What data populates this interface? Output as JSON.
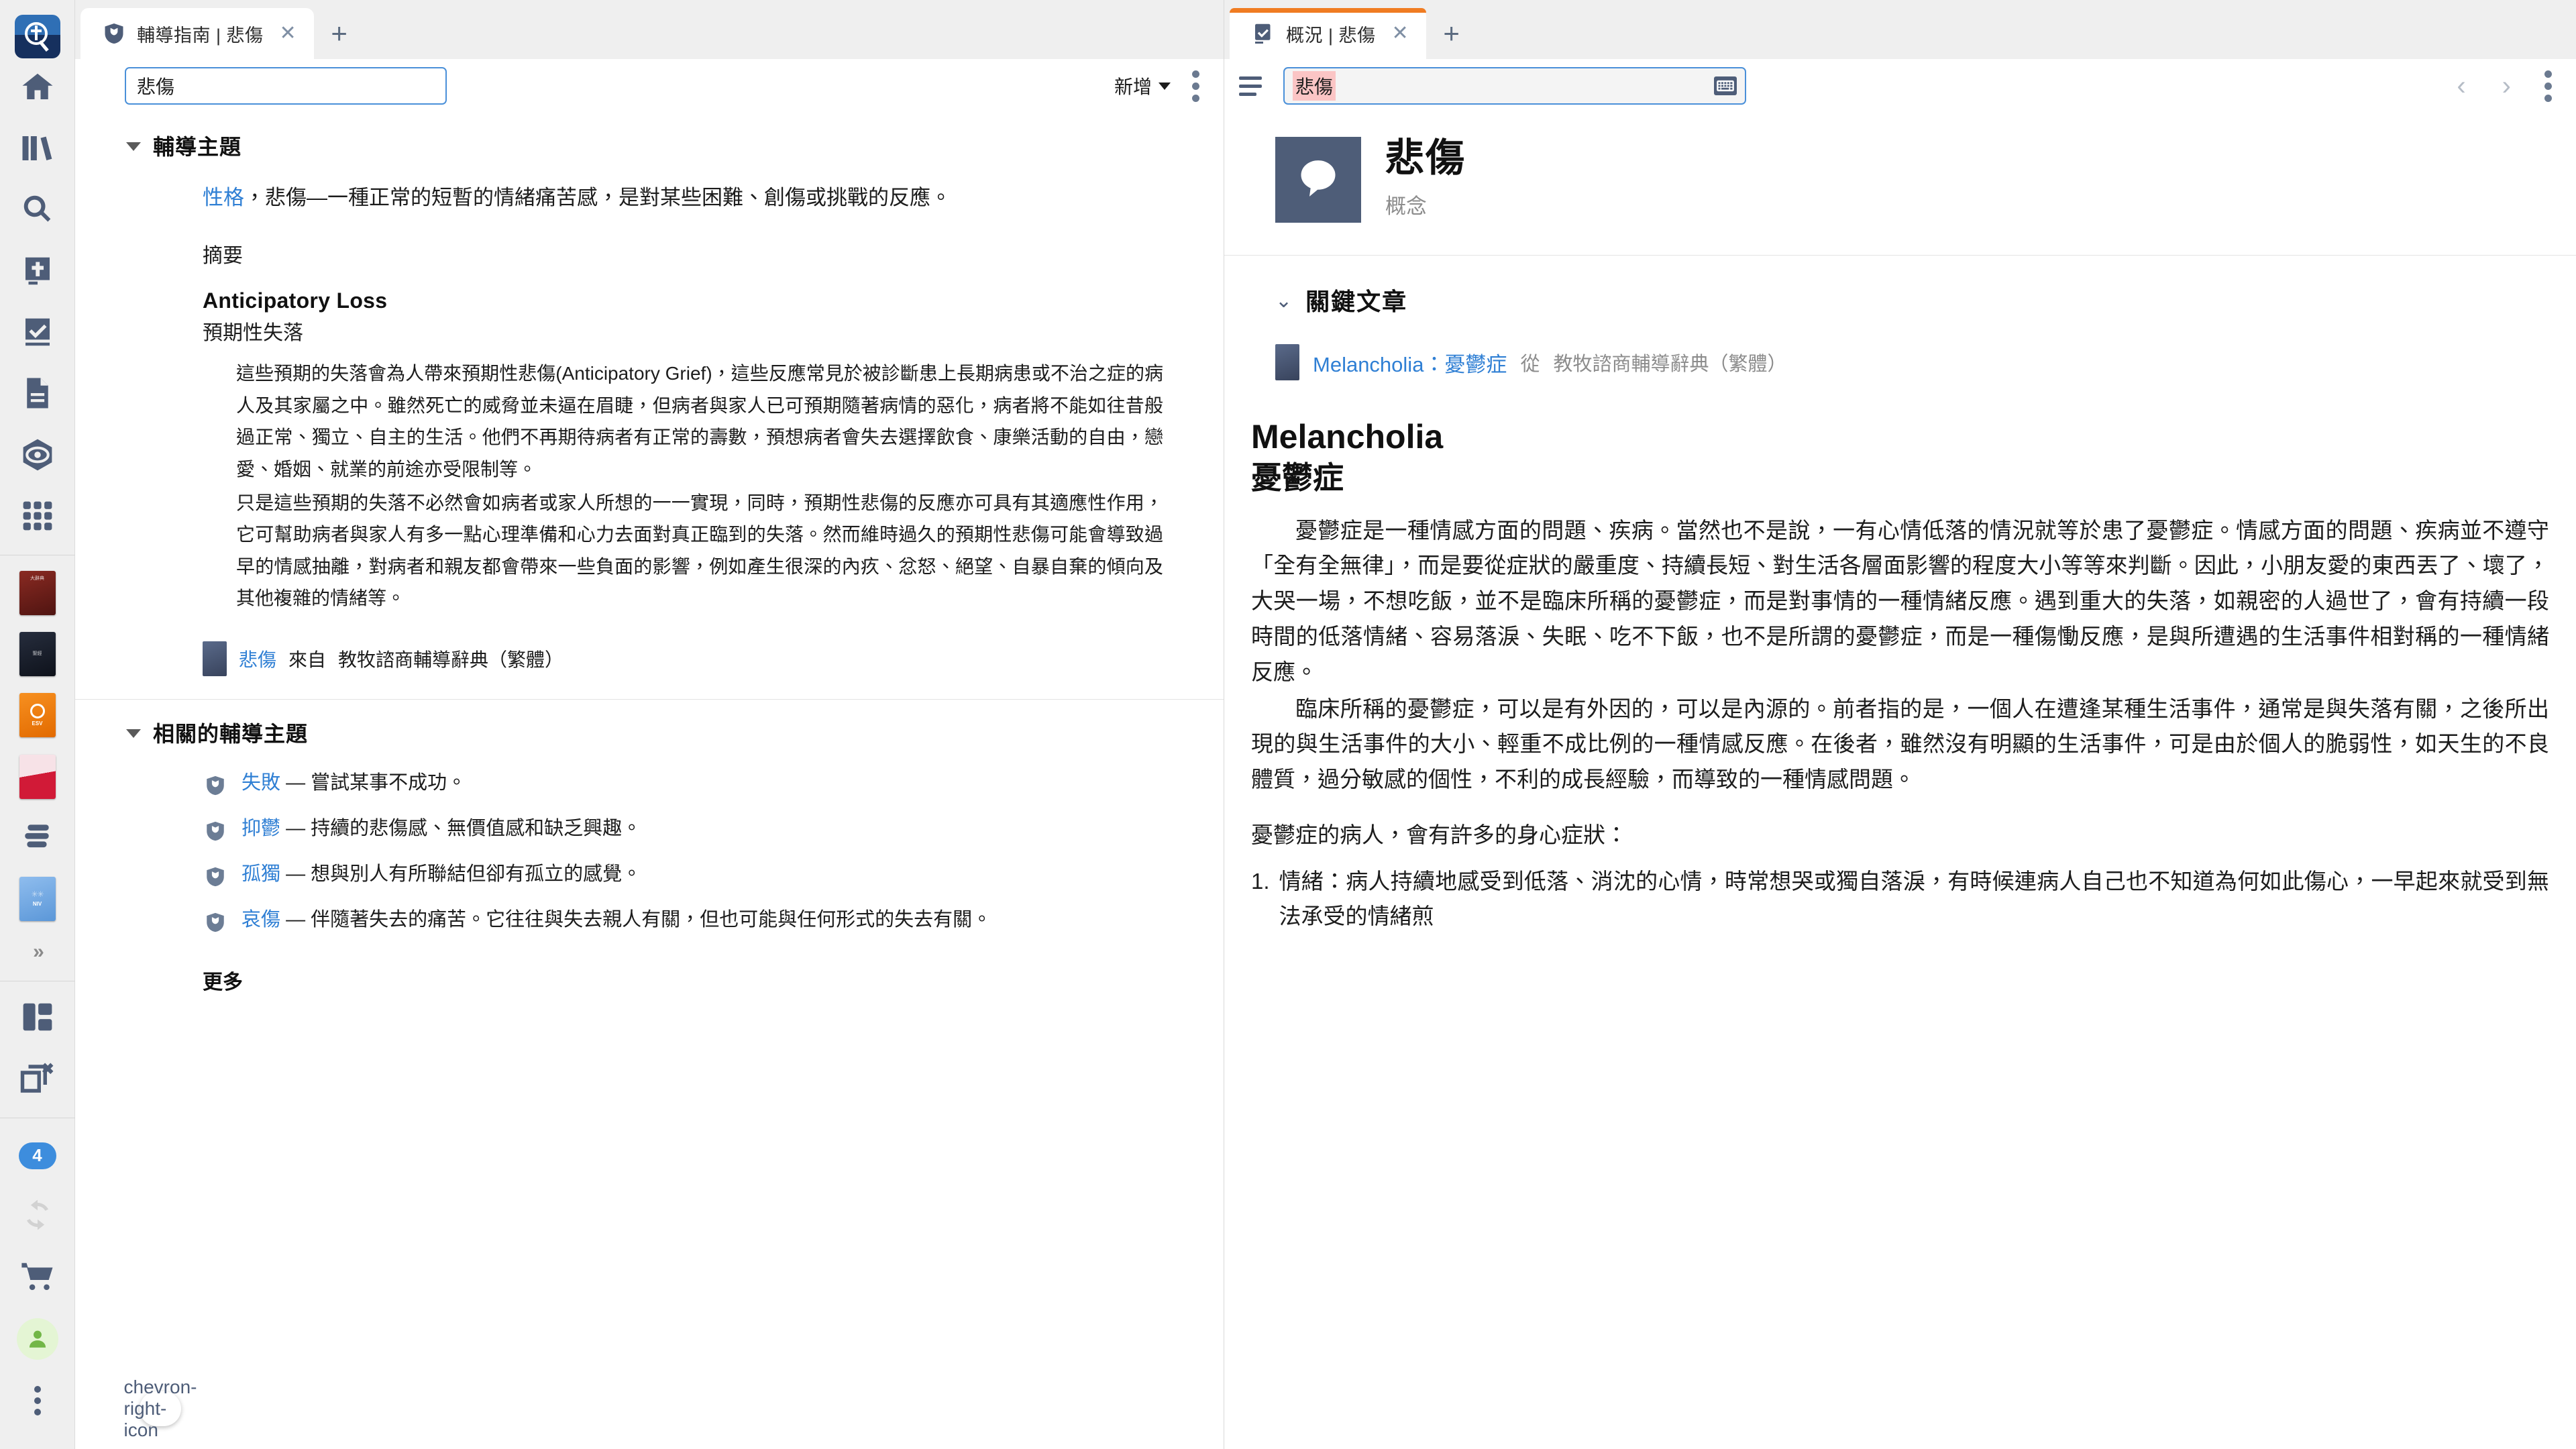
{
  "rail": {
    "logo_name": "logos-app-logo",
    "nav": [
      {
        "name": "home",
        "icon": "home-icon"
      },
      {
        "name": "library",
        "icon": "library-books-icon"
      },
      {
        "name": "search",
        "icon": "search-icon"
      },
      {
        "name": "bible",
        "icon": "bible-book-icon"
      },
      {
        "name": "reading-plan",
        "icon": "book-check-icon"
      },
      {
        "name": "documents",
        "icon": "document-icon"
      },
      {
        "name": "guides",
        "icon": "compass-eye-icon"
      },
      {
        "name": "tools",
        "icon": "grid-apps-icon"
      }
    ],
    "books": [
      {
        "name": "book-red",
        "color1": "#7e241e",
        "color2": "#5c1714",
        "label": "大辭典"
      },
      {
        "name": "book-dark",
        "color1": "#1d2330",
        "color2": "#11151f",
        "label": "聖經"
      },
      {
        "name": "book-orange",
        "color1": "#f3860f",
        "color2": "#e06c00",
        "label": "ESV"
      },
      {
        "name": "book-pink",
        "color1": "#f2d0d9",
        "color2": "#c4172c",
        "label": ""
      },
      {
        "name": "book-stack",
        "color1": "#6c7d95",
        "color2": "#6c7d95",
        "label": ""
      },
      {
        "name": "book-blue",
        "color1": "#77aee8",
        "color2": "#5e9ada",
        "label": "NIV"
      }
    ],
    "expand_more": "»",
    "layout_icon": "layout-panels-icon",
    "close_all_icon": "close-windows-icon",
    "notifications_count": "4",
    "sync_icon": "sync-icon",
    "store_icon": "shopping-cart-icon",
    "account_icon": "user-account-icon",
    "more_icon": "kebab-more-icon",
    "flyout_icon": "chevron-right-icon"
  },
  "left_pane": {
    "tab": {
      "icon": "guide-shield-icon",
      "title": "輔導指南 | 悲傷",
      "close": "✕",
      "new_tab": "+"
    },
    "toolbar": {
      "search_value": "悲傷",
      "search_placeholder": "悲傷",
      "add_label": "新增",
      "kebab": "more-options"
    },
    "section1": {
      "title": "輔導主題",
      "lead_link": "性格",
      "lead_rest": "，悲傷—一種正常的短暫的情緒痛苦感，是對某些困難、創傷或挑戰的反應。",
      "summary_label": "摘要",
      "entry_en": "Anticipatory Loss",
      "entry_cn": "預期性失落",
      "paragraphs": [
        "這些預期的失落會為人帶來預期性悲傷(Anticipatory Grief)，這些反應常見於被診斷患上長期病患或不治之症的病人及其家屬之中。雖然死亡的威脅並未逼在眉睫，但病者與家人已可預期隨著病情的惡化，病者將不能如往昔般過正常、獨立、自主的生活。他們不再期待病者有正常的壽數，預想病者會失去選擇飲食、康樂活動的自由，戀愛、婚姻、就業的前途亦受限制等。",
        "只是這些預期的失落不必然會如病者或家人所想的一一實現，同時，預期性悲傷的反應亦可具有其適應性作用，它可幫助病者與家人有多一點心理準備和心力去面對真正臨到的失落。然而維時過久的預期性悲傷可能會導致過早的情感抽離，對病者和親友都會帶來一些負面的影響，例如產生很深的內疚、忿怒、絕望、自暴自棄的傾向及其他複雜的情緒等。"
      ],
      "citation_link": "悲傷",
      "citation_from": "來自",
      "citation_source": "教牧諮商輔導辭典（繁體）"
    },
    "section2": {
      "title": "相關的輔導主題",
      "items": [
        {
          "link": "失敗",
          "desc": "— 嘗試某事不成功。"
        },
        {
          "link": "抑鬱",
          "desc": "— 持續的悲傷感、無價值感和缺乏興趣。"
        },
        {
          "link": "孤獨",
          "desc": "— 想與別人有所聯結但卻有孤立的感覺。"
        },
        {
          "link": "哀傷",
          "desc": "— 伴隨著失去的痛苦。它往往與失去親人有關，但也可能與任何形式的失去有關。"
        }
      ],
      "more_label": "更多"
    }
  },
  "right_pane": {
    "tab": {
      "icon": "factbook-check-icon",
      "title": "概況 | 悲傷",
      "close": "✕",
      "new_tab": "+",
      "accent_color": "#f07c22"
    },
    "toolbar": {
      "menu_icon": "list-menu-icon",
      "search_value": "悲傷",
      "search_placeholder": "悲傷",
      "keyboard_icon": "keyboard-icon",
      "back_icon": "‹",
      "forward_icon": "›",
      "kebab": "more-options"
    },
    "article": {
      "cover_icon": "speech-bubble-icon",
      "title": "悲傷",
      "subtitle": "概念",
      "key_articles_title": "關鍵文章",
      "key_link_en": "Melancholia",
      "key_link_sep": "：",
      "key_link_cn": "憂鬱症",
      "key_from": "從",
      "key_source": "教牧諮商輔導辭典（繁體）",
      "heading_en": "Melancholia",
      "heading_cn": "憂鬱症",
      "paragraphs": [
        "憂鬱症是一種情感方面的問題、疾病。當然也不是說，一有心情低落的情況就等於患了憂鬱症。情感方面的問題、疾病並不遵守「全有全無律」，而是要從症狀的嚴重度、持續長短、對生活各層面影響的程度大小等等來判斷。因此，小朋友愛的東西丟了、壞了，大哭一場，不想吃飯，並不是臨床所稱的憂鬱症，而是對事情的一種情緒反應。遇到重大的失落，如親密的人過世了，會有持續一段時間的低落情緒、容易落淚、失眠、吃不下飯，也不是所謂的憂鬱症，而是一種傷慟反應，是與所遭遇的生活事件相對稱的一種情緒反應。",
        "臨床所稱的憂鬱症，可以是有外因的，可以是內源的。前者指的是，一個人在遭逢某種生活事件，通常是與失落有關，之後所出現的與生活事件的大小、輕重不成比例的一種情感反應。在後者，雖然沒有明顯的生活事件，可是由於個人的脆弱性，如天生的不良體質，過分敏感的個性，不利的成長經驗，而導致的一種情感問題。"
      ],
      "list_intro": "憂鬱症的病人，會有許多的身心症狀：",
      "list": [
        {
          "num": "1.",
          "text": "情緒：病人持續地感受到低落、消沈的心情，時常想哭或獨自落淚，有時候連病人自己也不知道為何如此傷心，一早起來就受到無法承受的情緒煎"
        }
      ]
    }
  }
}
